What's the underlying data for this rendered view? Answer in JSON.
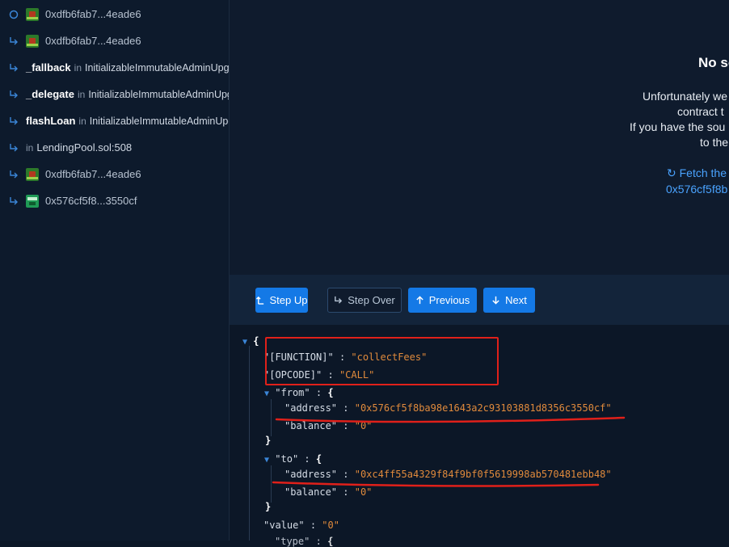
{
  "sidebar": {
    "items": [
      {
        "label": "0xdfb6fab7...4eade6"
      },
      {
        "label": "0xdfb6fab7...4eade6"
      },
      {
        "fn": "_fallback",
        "in": "in",
        "contract": "InitializableImmutableAdminUpg"
      },
      {
        "fn": "_delegate",
        "in": "in",
        "contract": "InitializableImmutableAdminUpg"
      },
      {
        "fn": "flashLoan",
        "in": "in",
        "contract": "InitializableImmutableAdminUpg"
      },
      {
        "in": "in",
        "file": "LendingPool.sol:508"
      },
      {
        "label": "0xdfb6fab7...4eade6"
      },
      {
        "label": "0x576cf5f8...3550cf"
      }
    ]
  },
  "source_panel": {
    "title": "No sc",
    "lines": [
      "Unfortunately we",
      "contract t",
      "If you have the sou",
      "to the"
    ],
    "fetch_label": "Fetch the",
    "fetch_address": "0x576cf5f8b"
  },
  "toolbar": {
    "step_up": "Step Up",
    "step_over": "Step Over",
    "previous": "Previous",
    "next": "Next"
  },
  "json": {
    "open_brace": "{",
    "close_brace": "}",
    "function_key": "\"[FUNCTION]\"",
    "function_val": "\"collectFees\"",
    "opcode_key": "\"[OPCODE]\"",
    "opcode_val": "\"CALL\"",
    "from_key": "\"from\"",
    "from_address_key": "\"address\"",
    "from_address_val": "\"0x576cf5f8ba98e1643a2c93103881d8356c3550cf\"",
    "from_balance_key": "\"balance\"",
    "from_balance_val": "\"0\"",
    "to_key": "\"to\"",
    "to_address_key": "\"address\"",
    "to_address_val": "\"0xc4ff55a4329f84f9bf0f5619998ab570481ebb48\"",
    "to_balance_key": "\"balance\"",
    "to_balance_val": "\"0\"",
    "value_key": "\"value\"",
    "value_val": "\"0\"",
    "next_key": "\"type\"",
    "colon": ":"
  },
  "colors": {
    "accent": "#1479e6",
    "string": "#e08a3c",
    "annotation": "#e0201a"
  }
}
